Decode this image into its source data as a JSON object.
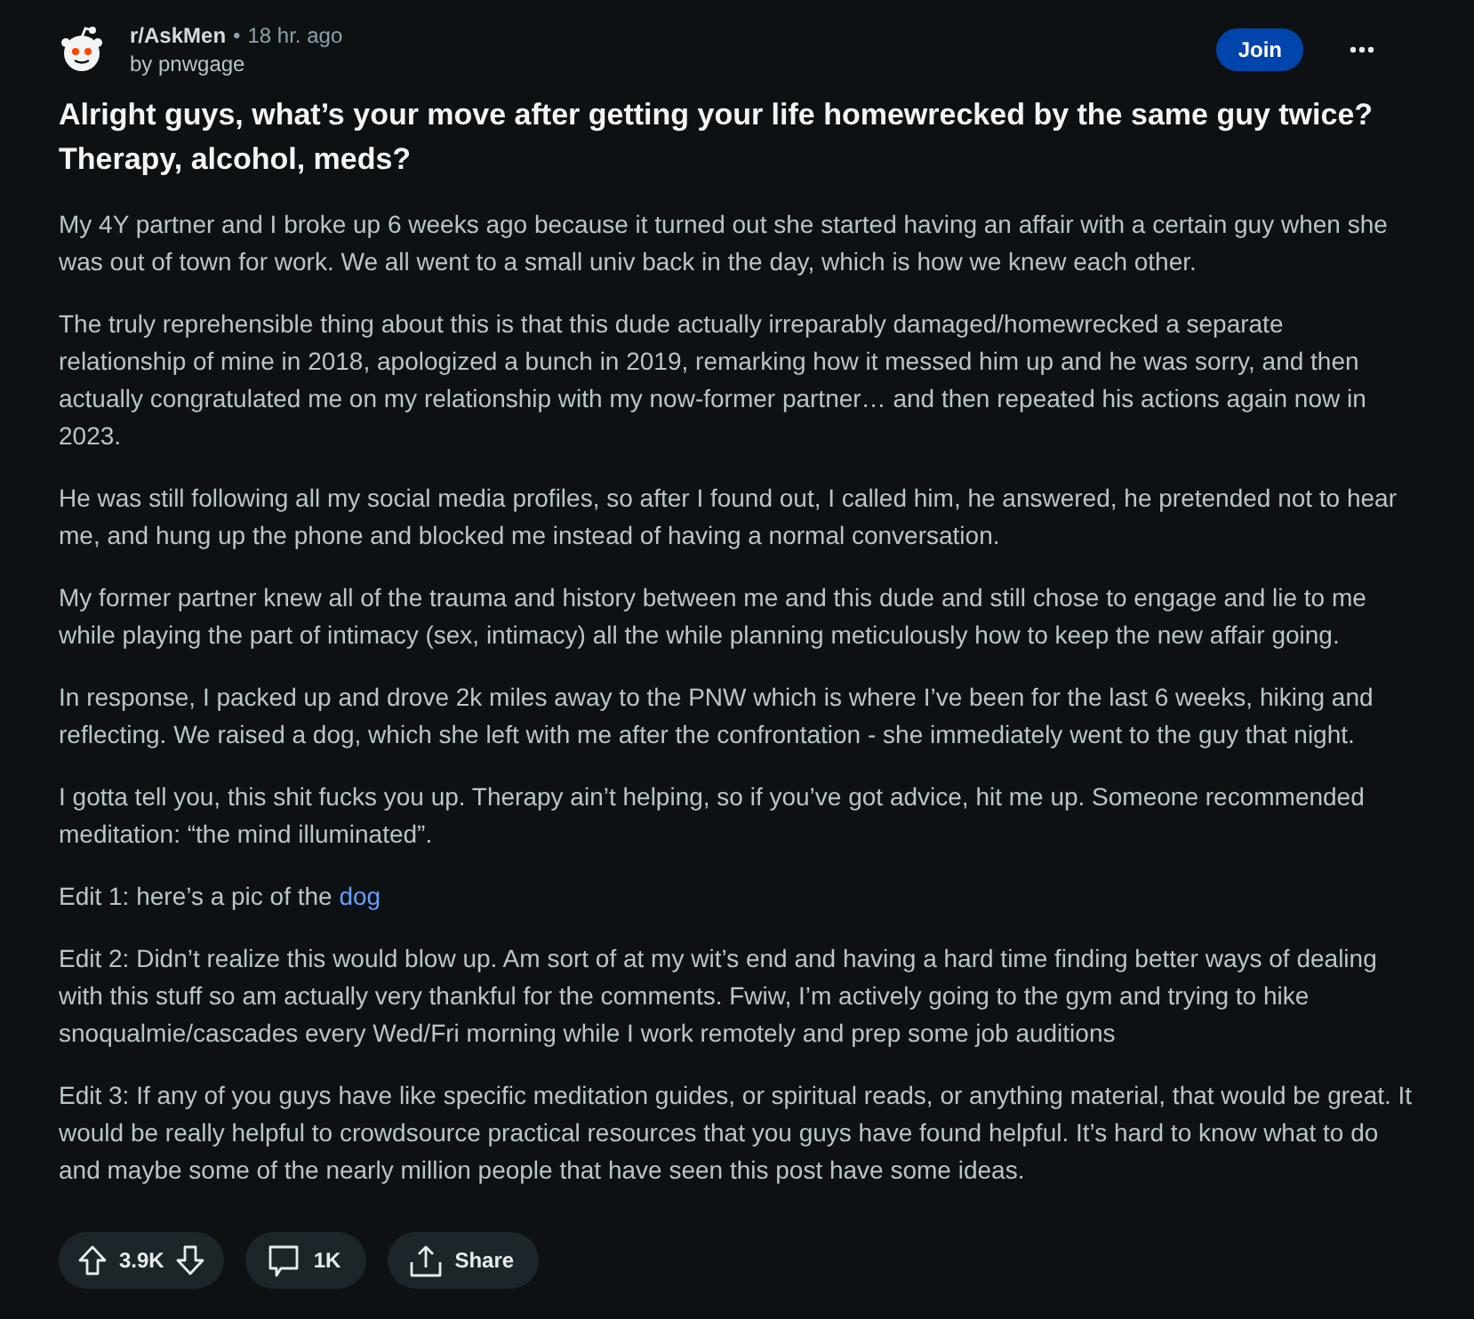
{
  "post": {
    "subreddit": "r/AskMen",
    "separator": "•",
    "time": "18 hr. ago",
    "author": "by pnwgage",
    "join_label": "Join",
    "title": "Alright guys, what’s your move after getting your life homewrecked by the same guy twice? Therapy, alcohol, meds?",
    "body": [
      {
        "text": "My 4Y partner and I broke up 6 weeks ago because it turned out she started having an affair with a certain guy when she was out of town for work. We all went to a small univ back in the day, which is how we knew each other."
      },
      {
        "text": "The truly reprehensible thing about this is that this dude actually irreparably damaged/homewrecked a separate relationship of mine in 2018, apologized a bunch in 2019, remarking how it messed him up and he was sorry, and then actually congratulated me on my relationship with my now-former partner… and then repeated his actions again now in 2023."
      },
      {
        "text": "He was still following all my social media profiles, so after I found out, I called him, he answered, he pretended not to hear me, and hung up the phone and blocked me instead of having a normal conversation."
      },
      {
        "text": "My former partner knew all of the trauma and history between me and this dude and still chose to engage and lie to me while playing the part of intimacy (sex, intimacy) all the while planning meticulously how to keep the new affair going."
      },
      {
        "text": "In response, I packed up and drove 2k miles away to the PNW which is where I’ve been for the last 6 weeks, hiking and reflecting. We raised a dog, which she left with me after the confrontation - she immediately went to the guy that night."
      },
      {
        "text": "I gotta tell you, this shit fucks you up. Therapy ain’t helping, so if you’ve got advice, hit me up. Someone recommended meditation: “the mind illuminated”."
      },
      {
        "text": "Edit 1: here’s a pic of the",
        "link": "dog"
      },
      {
        "text": "Edit 2: Didn’t realize this would blow up. Am sort of at my wit’s end and having a hard time finding better ways of dealing with this stuff so am actually very thankful for the comments. Fwiw, I’m actively going to the gym and trying to hike snoqualmie/cascades every Wed/Fri morning while I work remotely and prep some job auditions"
      },
      {
        "text": "Edit 3: If any of you guys have like specific meditation guides, or spiritual reads, or anything material, that would be great. It would be really helpful to crowdsource practical resources that you guys have found helpful. It’s hard to know what to do and maybe some of the nearly million people that have seen this post have some ideas."
      }
    ]
  },
  "actions": {
    "score": "3.9K",
    "comments": "1K",
    "share": "Share"
  }
}
